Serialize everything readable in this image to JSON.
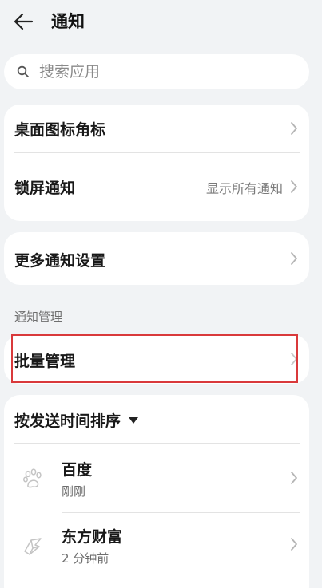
{
  "header": {
    "title": "通知",
    "back_icon": "arrow-left-icon"
  },
  "search": {
    "placeholder": "搜索应用",
    "value": "",
    "icon": "search-icon"
  },
  "settings_card_1": {
    "items": [
      {
        "label": "桌面图标角标",
        "value": ""
      },
      {
        "label": "锁屏通知",
        "value": "显示所有通知"
      }
    ]
  },
  "settings_card_2": {
    "items": [
      {
        "label": "更多通知设置"
      }
    ]
  },
  "management": {
    "section_title": "通知管理",
    "batch_label": "批量管理",
    "highlight_color": "#d9393b"
  },
  "apps": {
    "sort_label": "按发送时间排序",
    "list": [
      {
        "name": "百度",
        "time": "刚刚",
        "icon": "baidu-paw-icon"
      },
      {
        "name": "东方财富",
        "time": "2 分钟前",
        "icon": "eastmoney-icon"
      }
    ]
  },
  "colors": {
    "background": "#f1f3f5",
    "card": "#ffffff",
    "secondary_text": "#7a7a7a"
  }
}
